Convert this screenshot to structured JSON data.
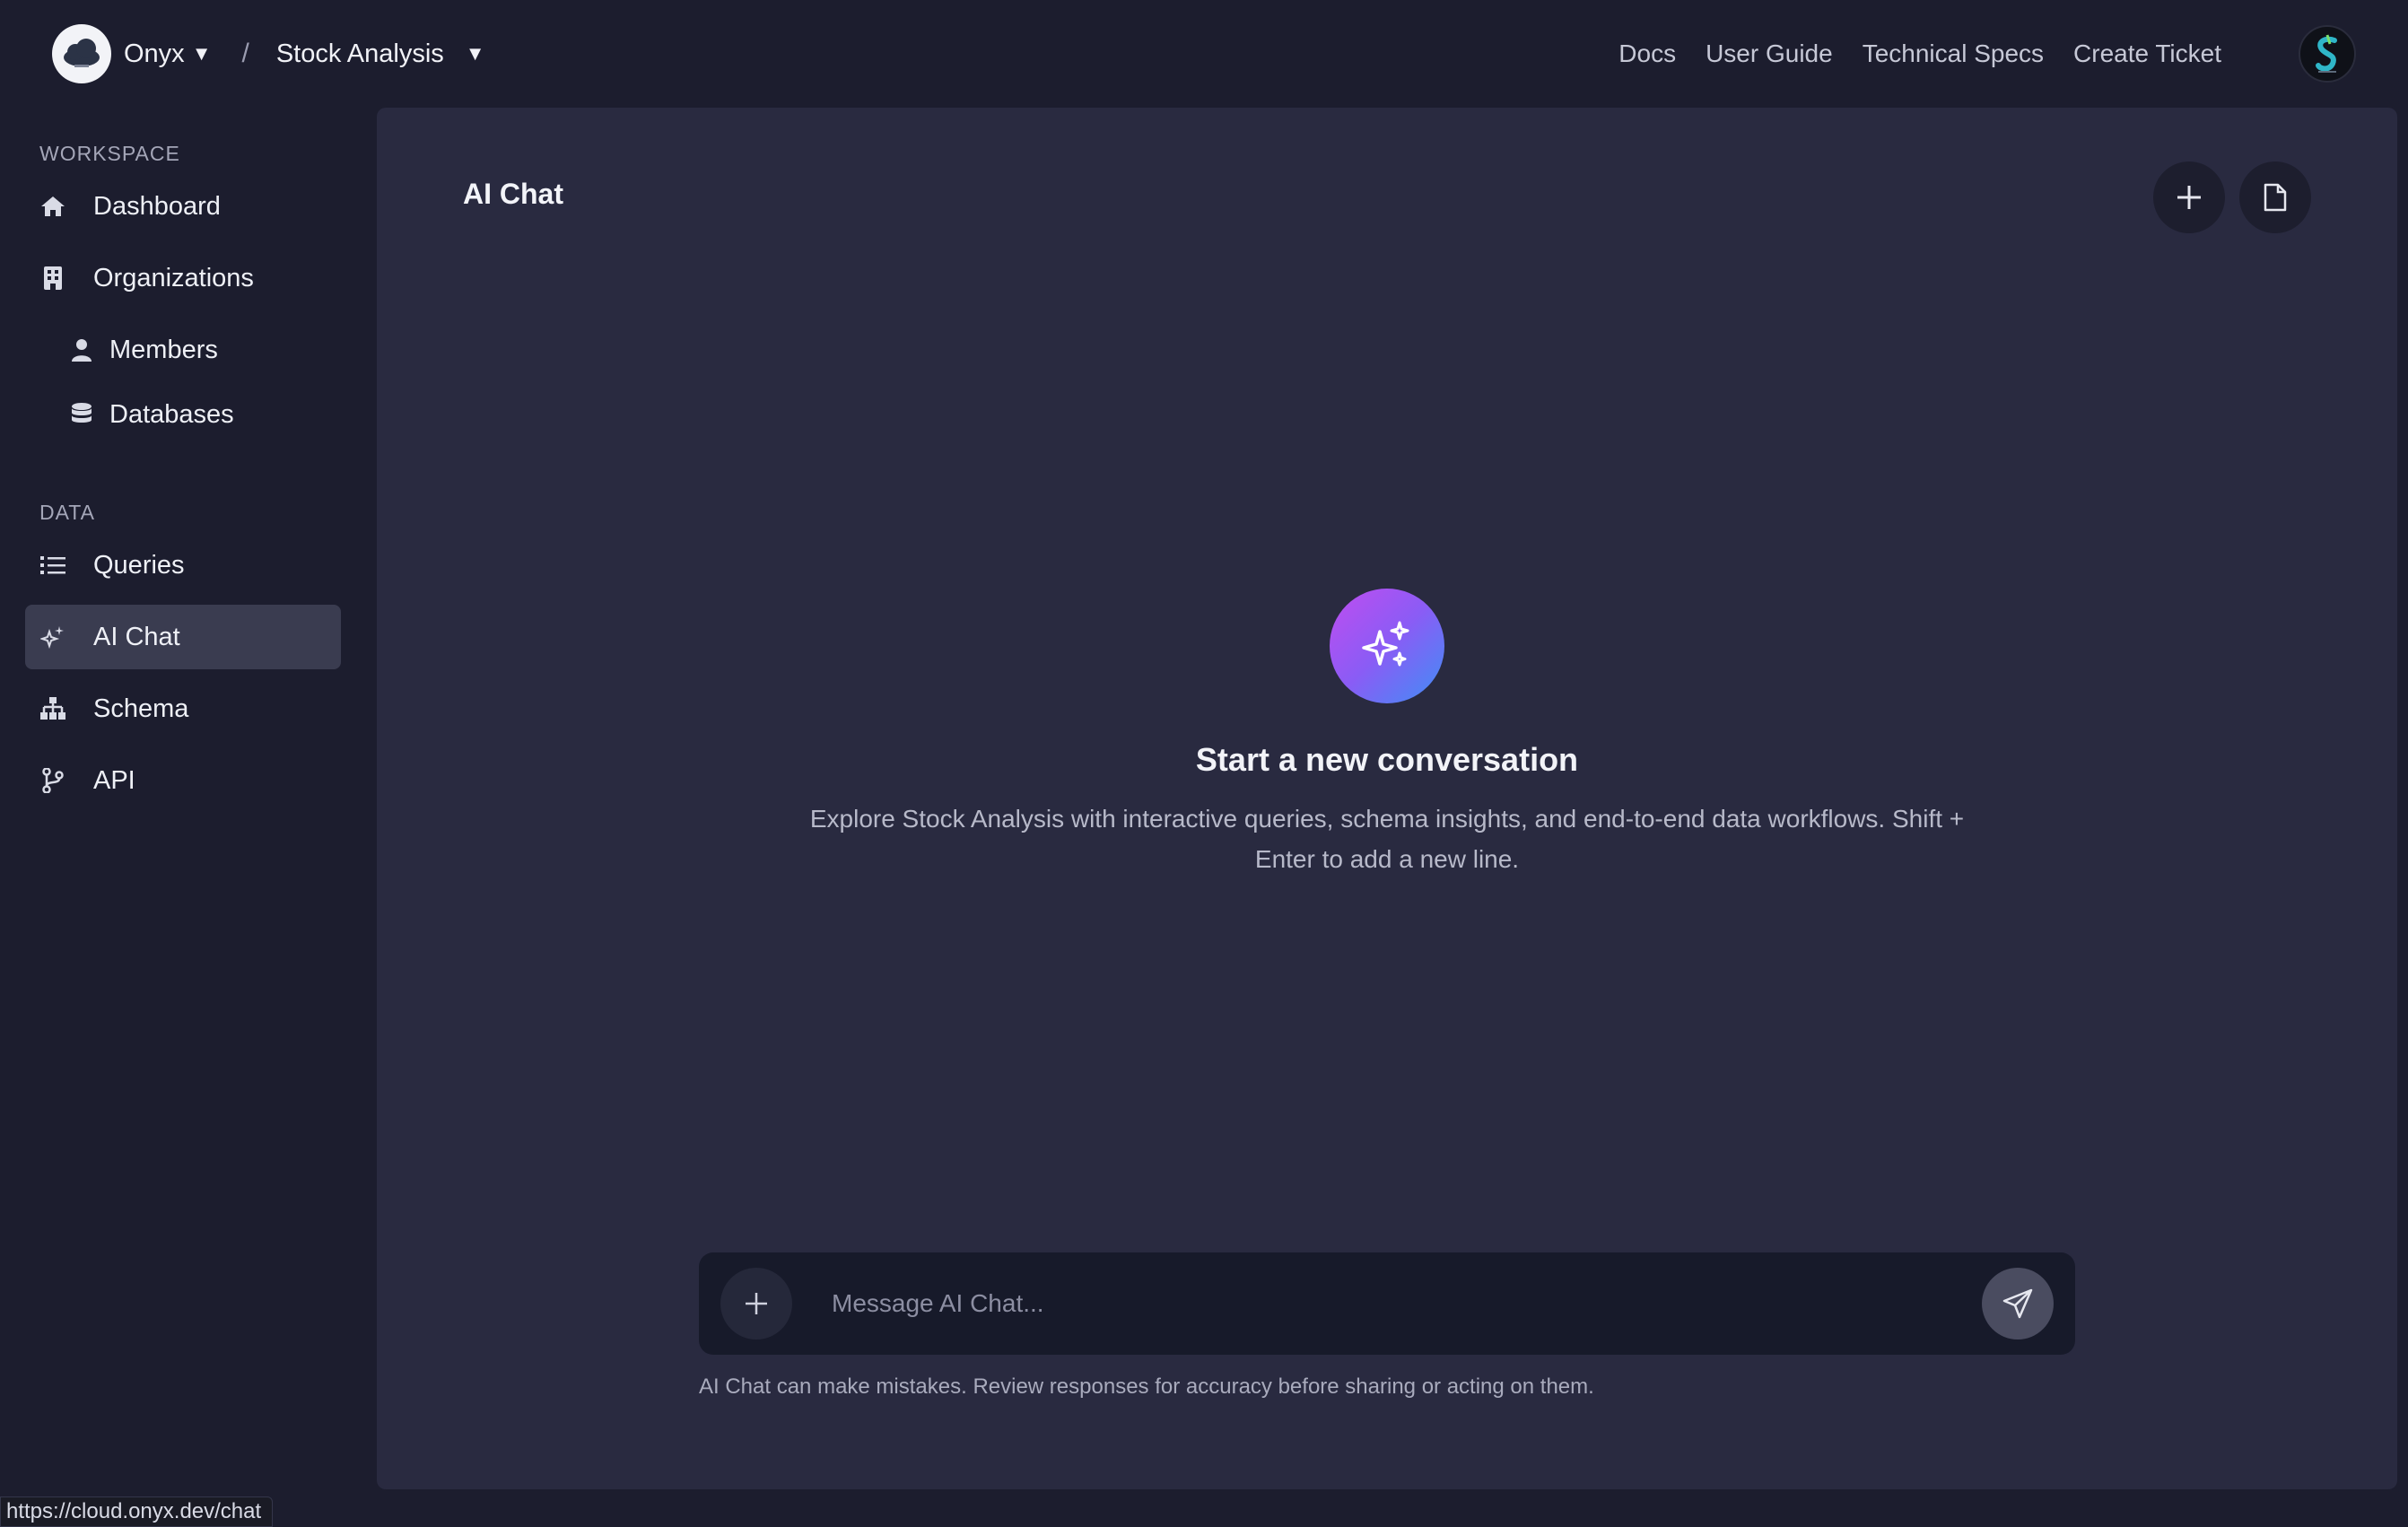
{
  "header": {
    "brand": "Onyx",
    "separator": "/",
    "project": "Stock Analysis",
    "nav": [
      "Docs",
      "User Guide",
      "Technical Specs",
      "Create Ticket"
    ]
  },
  "sidebar": {
    "workspace_label": "WORKSPACE",
    "data_label": "DATA",
    "items": {
      "dashboard": "Dashboard",
      "organizations": "Organizations",
      "members": "Members",
      "databases": "Databases",
      "queries": "Queries",
      "ai_chat": "AI Chat",
      "schema": "Schema",
      "api": "API"
    },
    "active": "AI Chat"
  },
  "main": {
    "title": "AI Chat",
    "empty_title": "Start a new conversation",
    "empty_desc": "Explore Stock Analysis with interactive queries, schema insights, and end-to-end data workflows. Shift + Enter to add a new line.",
    "composer_placeholder": "Message AI Chat...",
    "disclaimer": "AI Chat can make mistakes. Review responses for accuracy before sharing or acting on them."
  },
  "status_url": "https://cloud.onyx.dev/chat",
  "colors": {
    "background": "#1c1d2e",
    "panel": "#292a40",
    "active_item": "#3a3c50",
    "accent_gradient_start": "#c04df0",
    "accent_gradient_end": "#3f8ff5"
  }
}
